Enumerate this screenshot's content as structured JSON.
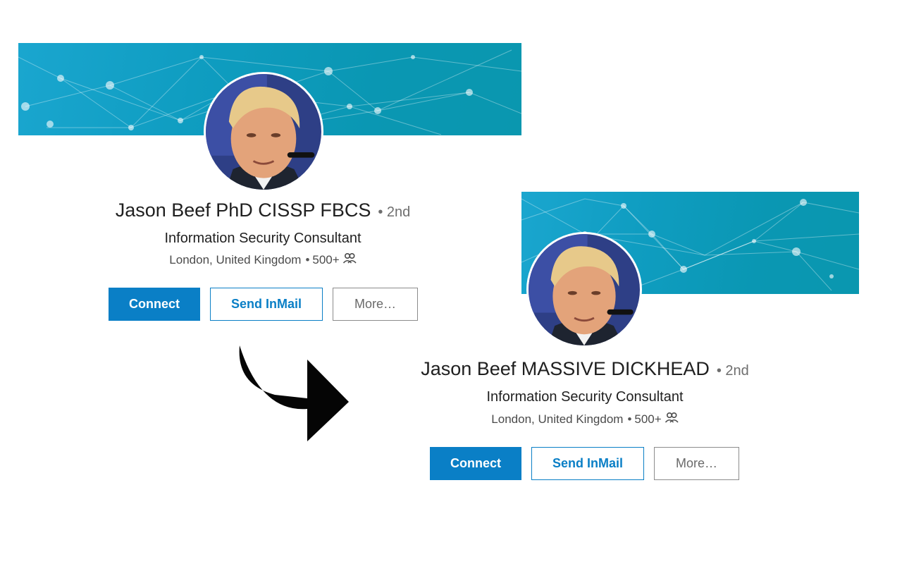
{
  "before_profile": {
    "name": "Jason Beef PhD CISSP FBCS",
    "degree": "• 2nd",
    "headline": "Information Security Consultant",
    "location": "London, United Kingdom",
    "separator": "•",
    "connections": "500+",
    "buttons": {
      "connect": "Connect",
      "send_inmail": "Send InMail",
      "more": "More…"
    }
  },
  "after_profile": {
    "name": "Jason Beef MASSIVE DICKHEAD",
    "degree": "• 2nd",
    "headline": "Information Security Consultant",
    "location": "London, United Kingdom",
    "separator": "•",
    "connections": "500+",
    "buttons": {
      "connect": "Connect",
      "send_inmail": "Send InMail",
      "more": "More…"
    }
  },
  "icons": {
    "connections": "people-icon",
    "transition": "curved-arrow-icon"
  },
  "colors": {
    "primary_blue": "#0a7fc6",
    "banner_teal": "#0f9dc1",
    "text_dark": "#202020",
    "text_muted": "#6e6e6e"
  }
}
